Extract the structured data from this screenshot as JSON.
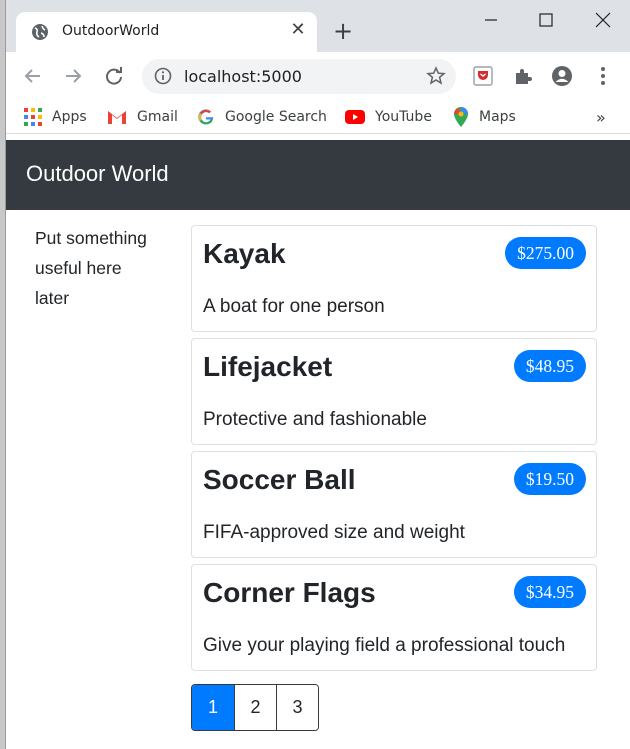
{
  "browser": {
    "tab_title": "OutdoorWorld",
    "new_tab_symbol": "+",
    "address": "localhost:5000",
    "bookmarks": [
      {
        "label": "Apps",
        "icon": "apps-grid-icon"
      },
      {
        "label": "Gmail",
        "icon": "gmail-icon"
      },
      {
        "label": "Google Search",
        "icon": "google-icon"
      },
      {
        "label": "YouTube",
        "icon": "youtube-icon"
      },
      {
        "label": "Maps",
        "icon": "maps-icon"
      }
    ],
    "bookmarks_more": "»"
  },
  "site": {
    "brand": "Outdoor World",
    "side_note": "Put something useful here later",
    "accent_color": "#007bff",
    "navbar_color": "#343a40"
  },
  "products": [
    {
      "name": "Kayak",
      "price": "$275.00",
      "description": "A boat for one person"
    },
    {
      "name": "Lifejacket",
      "price": "$48.95",
      "description": "Protective and fashionable"
    },
    {
      "name": "Soccer Ball",
      "price": "$19.50",
      "description": "FIFA-approved size and weight"
    },
    {
      "name": "Corner Flags",
      "price": "$34.95",
      "description": "Give your playing field a professional touch"
    }
  ],
  "pagination": {
    "pages": [
      "1",
      "2",
      "3"
    ],
    "current": "1"
  }
}
